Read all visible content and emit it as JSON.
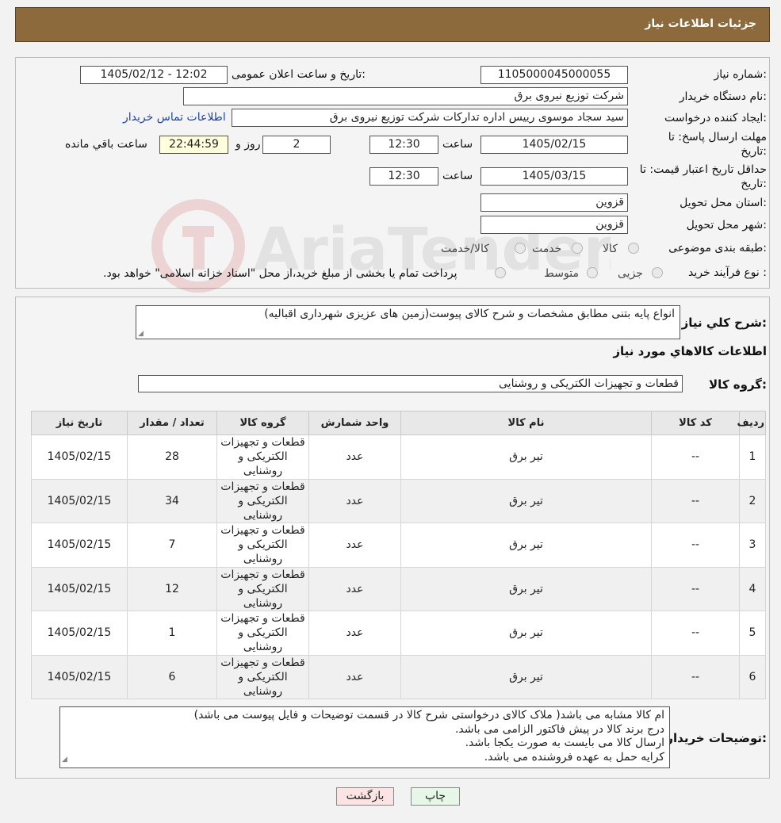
{
  "header": {
    "title": "جزئیات اطلاعات نیاز"
  },
  "form": {
    "need_number_label": "شماره نیاز:",
    "need_number": "1105000045000055",
    "announce_label": "تاریخ و ساعت اعلان عمومی:",
    "announce_value": "1405/02/12 - 12:02",
    "buyer_org_label": "نام دستگاه خریدار:",
    "buyer_org": "شرکت توزیع نیروی برق",
    "creator_label": "ایجاد کننده درخواست:",
    "creator": "سید سجاد موسوی رییس اداره تدارکات شرکت توزیع نیروی برق",
    "contact_link": "اطلاعات تماس خریدار",
    "reply_deadline_label_1": "مهلت ارسال پاسخ: تا",
    "reply_deadline_label_2": "تاریخ:",
    "reply_date": "1405/02/15",
    "time_label": "ساعت",
    "reply_time": "12:30",
    "days": "2",
    "days_label": "روز و",
    "remaining_timer": "22:44:59",
    "remaining_label": "ساعت باقي مانده",
    "price_validity_label_1": "حداقل تاریخ اعتبار قیمت: تا",
    "price_validity_label_2": "تاریخ:",
    "price_date": "1405/03/15",
    "price_time": "12:30",
    "province_label": "استان محل تحویل:",
    "province": "قزوین",
    "city_label": "شهر محل تحویل:",
    "city": "قزوین",
    "category_label": "طبقه بندی موضوعی:",
    "category_options": [
      "کالا",
      "خدمت",
      "کالا/خدمت"
    ],
    "process_label": "نوع فرآیند خرید :",
    "process_options": [
      "جزیی",
      "متوسط"
    ],
    "process_note": "پرداخت تمام یا بخشی از مبلغ خرید،از محل \"اسناد خزانه اسلامی\" خواهد بود."
  },
  "summary": {
    "label": "شرح کلي نياز:",
    "text": "انواع پایه بتنی مطابق مشخصات و شرح کالای پیوست(زمین های عزیزی شهرداری اقبالیه)"
  },
  "goods": {
    "section_title": "اطلاعات کالاهاي مورد نياز",
    "group_label": "گروه کالا:",
    "group_value": "قطعات و تجهیزات الکتریکی و روشنایی",
    "columns": [
      "ردیف",
      "کد کالا",
      "نام کالا",
      "واحد شمارش",
      "گروه کالا",
      "تعداد / مقدار",
      "تاریخ نیاز"
    ],
    "rows": [
      {
        "row": "1",
        "code": "--",
        "name": "تیر برق",
        "unit": "عدد",
        "group": "قطعات و تجهیزات الکتریکی و روشنایی",
        "qty": "28",
        "date": "1405/02/15"
      },
      {
        "row": "2",
        "code": "--",
        "name": "تیر برق",
        "unit": "عدد",
        "group": "قطعات و تجهیزات الکتریکی و روشنایی",
        "qty": "34",
        "date": "1405/02/15"
      },
      {
        "row": "3",
        "code": "--",
        "name": "تیر برق",
        "unit": "عدد",
        "group": "قطعات و تجهیزات الکتریکی و روشنایی",
        "qty": "7",
        "date": "1405/02/15"
      },
      {
        "row": "4",
        "code": "--",
        "name": "تیر برق",
        "unit": "عدد",
        "group": "قطعات و تجهیزات الکتریکی و روشنایی",
        "qty": "12",
        "date": "1405/02/15"
      },
      {
        "row": "5",
        "code": "--",
        "name": "تیر برق",
        "unit": "عدد",
        "group": "قطعات و تجهیزات الکتریکی و روشنایی",
        "qty": "1",
        "date": "1405/02/15"
      },
      {
        "row": "6",
        "code": "--",
        "name": "تیر برق",
        "unit": "عدد",
        "group": "قطعات و تجهیزات الکتریکی و روشنایی",
        "qty": "6",
        "date": "1405/02/15"
      }
    ]
  },
  "buyer_notes": {
    "label": "توضیحات خریدار:",
    "lines": [
      "ام کالا مشابه می باشد( ملاک کالای درخواستی شرح کالا در قسمت توضیحات و فایل پیوست می باشد)",
      "درج برند کالا در پیش فاکتور الزامی می باشد.",
      "ارسال کالا می بایست به صورت یکجا باشد.",
      "کرایه حمل به عهده فروشنده می باشد."
    ]
  },
  "buttons": {
    "print": "چاپ",
    "back": "بازگشت"
  },
  "watermark": {
    "text": "AriaTender.neT"
  },
  "colors": {
    "header": "#8c6a3c",
    "link": "#1a44b8",
    "timer_bg": "#ffffdd"
  },
  "icons": {
    "watermark_logo": "aria-logo-icon",
    "resize": "resize-grip-icon"
  }
}
